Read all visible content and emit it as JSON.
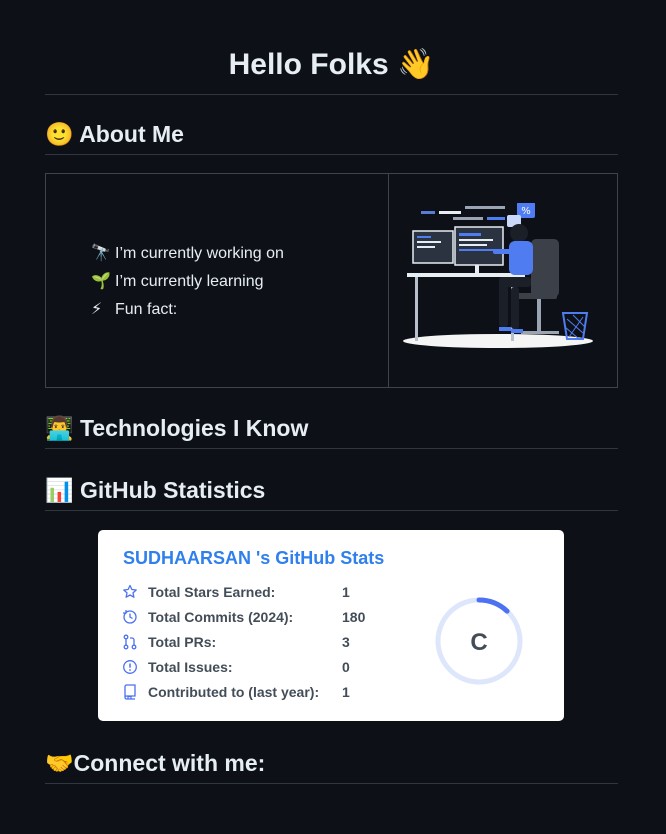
{
  "heading": {
    "text": "Hello Folks",
    "emoji": "👋"
  },
  "about": {
    "title": "About Me",
    "emoji": "🙂",
    "items": [
      {
        "icon": "🔭",
        "text": "I’m currently working on"
      },
      {
        "icon": "🌱",
        "text": "I’m currently learning"
      },
      {
        "icon": "⚡",
        "text": "Fun fact:"
      }
    ],
    "illustration": "developer-at-desk-illustration"
  },
  "technologies": {
    "title": "Technologies I Know",
    "emoji": "👨‍💻"
  },
  "stats_section": {
    "title": "GitHub Statistics",
    "emoji": "📊"
  },
  "stats_card": {
    "title": "SUDHAARSAN 's GitHub Stats",
    "rows": [
      {
        "icon": "star-icon",
        "label": "Total Stars Earned:",
        "value": "1"
      },
      {
        "icon": "history-icon",
        "label": "Total Commits (2024):",
        "value": "180"
      },
      {
        "icon": "pull-request-icon",
        "label": "Total PRs:",
        "value": "3"
      },
      {
        "icon": "issue-icon",
        "label": "Total Issues:",
        "value": "0"
      },
      {
        "icon": "repo-icon",
        "label": "Contributed to (last year):",
        "value": "1"
      }
    ],
    "rank": "C",
    "rank_progress": 0.12,
    "accent_color": "#2f80ed"
  },
  "connect": {
    "title": "Connect with me:",
    "emoji": "🤝"
  }
}
